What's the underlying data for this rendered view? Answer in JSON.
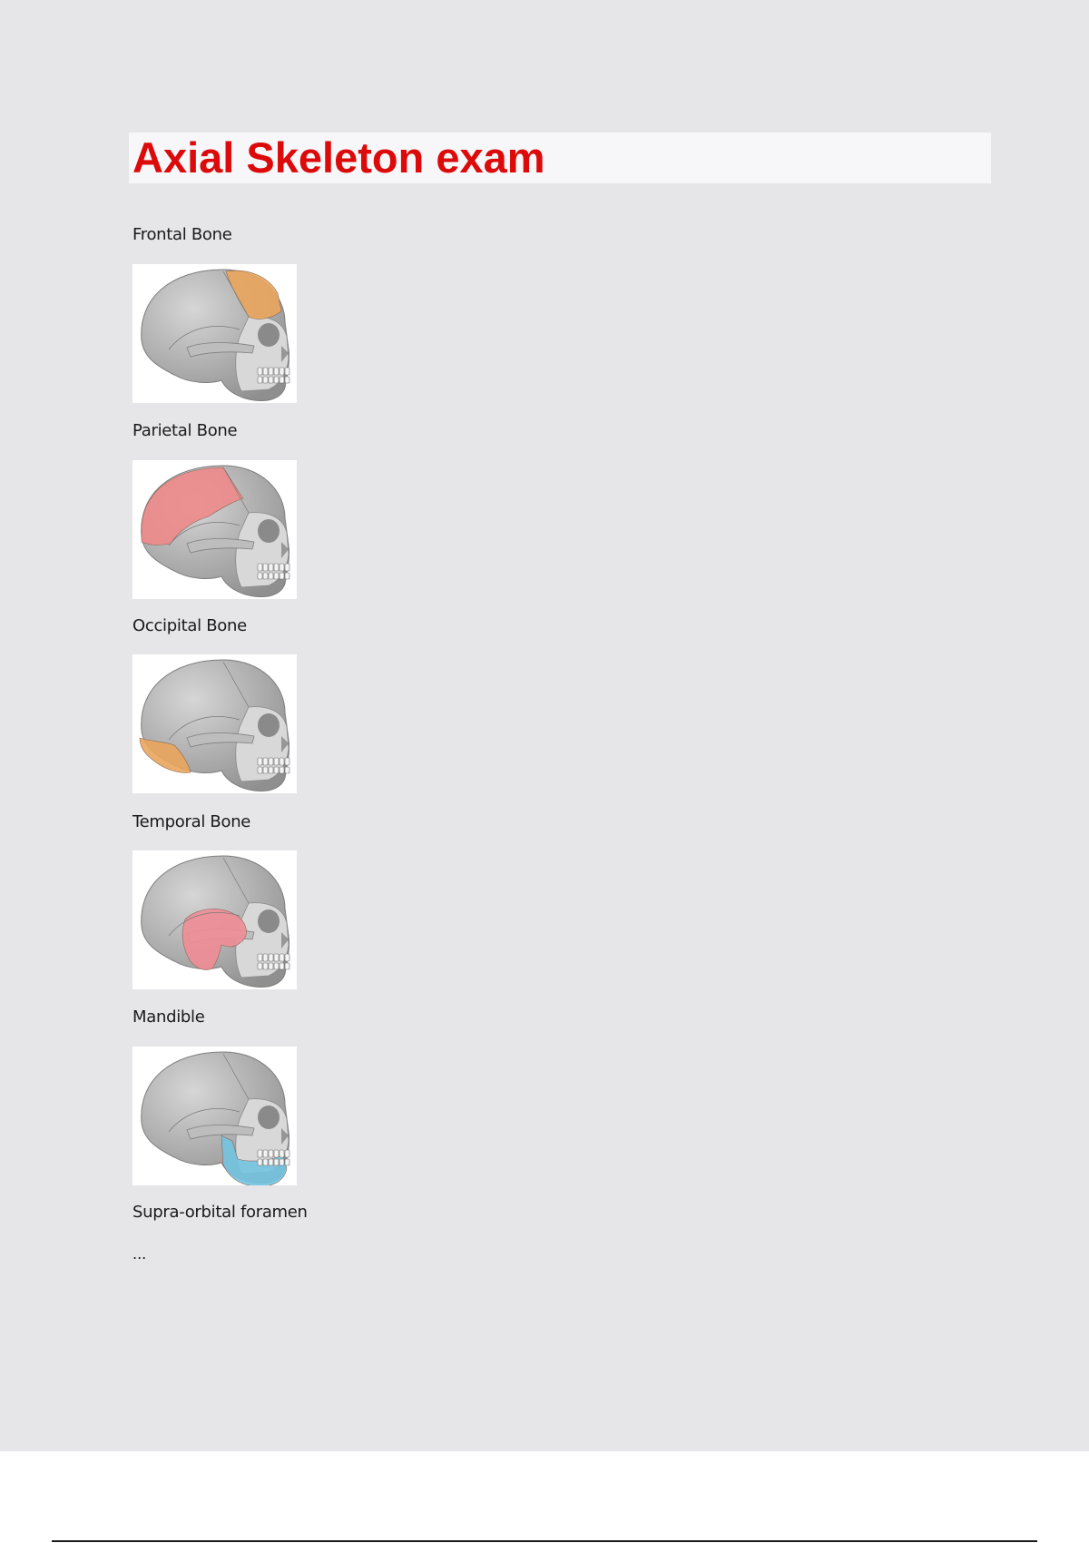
{
  "document": {
    "title": "Axial Skeleton exam",
    "title_color": "#dc0a0a",
    "sections": [
      {
        "label": "Frontal Bone",
        "highlight_region": "frontal",
        "highlight_color": "#e9a55c"
      },
      {
        "label": "Parietal Bone",
        "highlight_region": "parietal",
        "highlight_color": "#ee8a8a"
      },
      {
        "label": "Occipital Bone",
        "highlight_region": "occipital",
        "highlight_color": "#e9a55c"
      },
      {
        "label": "Temporal Bone",
        "highlight_region": "temporal",
        "highlight_color": "#f08c96"
      },
      {
        "label": "Mandible",
        "highlight_region": "mandible",
        "highlight_color": "#74c3e0"
      }
    ],
    "trailing_label": "Supra-orbital foramen",
    "ellipsis": "..."
  }
}
